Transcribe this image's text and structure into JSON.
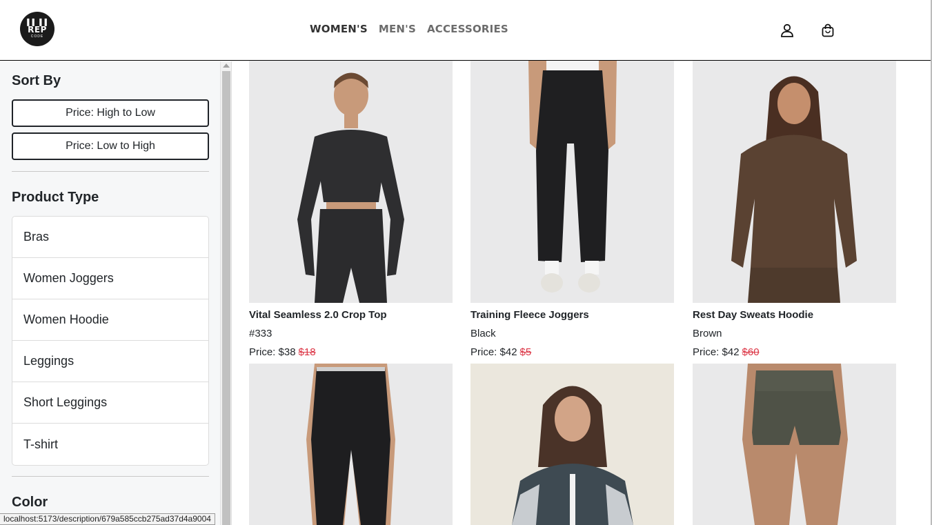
{
  "header": {
    "logo": {
      "top": "▌▌▐▐",
      "main": "REP",
      "sub": "CODE"
    },
    "nav": [
      "WOMEN'S",
      "MEN'S",
      "ACCESSORIES"
    ],
    "icons": [
      "user-icon",
      "shopping-bag-icon"
    ]
  },
  "sidebar": {
    "sort_title": "Sort By",
    "sort_options": [
      "Price: High to Low",
      "Price: Low to High"
    ],
    "type_title": "Product Type",
    "types": [
      "Bras",
      "Women Joggers",
      "Women Hoodie",
      "Leggings",
      "Short Leggings",
      "T-shirt"
    ],
    "color_title": "Color"
  },
  "status_bar": "localhost:5173/description/679a585ccb275ad37d4a9004",
  "products": [
    {
      "name": "Vital Seamless 2.0 Crop Top",
      "sub": "#333",
      "price_label": "Price: $38",
      "old_price": "$18"
    },
    {
      "name": "Training Fleece Joggers",
      "sub": "Black",
      "price_label": "Price: $42",
      "old_price": "$5"
    },
    {
      "name": "Rest Day Sweats Hoodie",
      "sub": "Brown",
      "price_label": "Price: $42",
      "old_price": "$60"
    }
  ],
  "colors": {
    "accent_red": "#dc3545",
    "border_dark": "#1f2328"
  }
}
